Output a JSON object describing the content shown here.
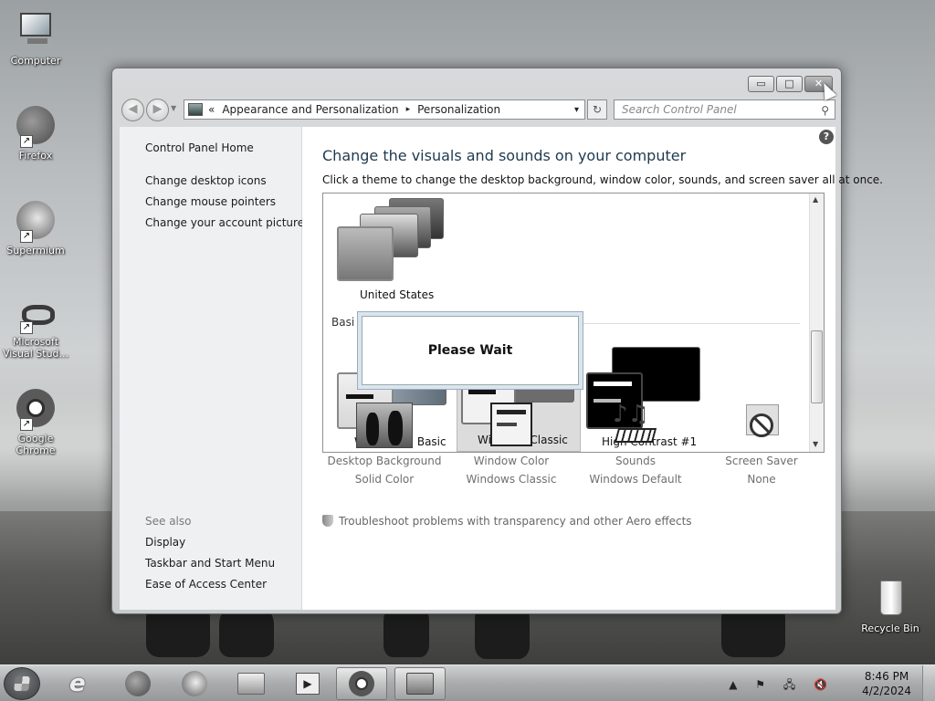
{
  "desktop": {
    "icons": [
      {
        "label": "Computer",
        "icon": "computer-icon"
      },
      {
        "label": "Firefox",
        "icon": "firefox-icon"
      },
      {
        "label": "Supermium",
        "icon": "supermium-icon"
      },
      {
        "label": "Microsoft Visual Stud...",
        "icon": "visual-studio-icon"
      },
      {
        "label": "Google Chrome",
        "icon": "chrome-icon"
      },
      {
        "label": "Recycle Bin",
        "icon": "recycle-bin-icon"
      }
    ]
  },
  "window": {
    "caption_buttons": {
      "minimize": "▭",
      "maximize": "□",
      "close": "✕"
    },
    "breadcrumb": {
      "prefix": "«",
      "parent": "Appearance and Personalization",
      "separator": "▸",
      "current": "Personalization",
      "dropdown": "▾"
    },
    "refresh_glyph": "↻",
    "search": {
      "placeholder": "Search Control Panel",
      "icon": "⚲"
    },
    "left_pane": {
      "home": "Control Panel Home",
      "links": [
        "Change desktop icons",
        "Change mouse pointers",
        "Change your account picture"
      ],
      "see_also_label": "See also",
      "see_also": [
        "Display",
        "Taskbar and Start Menu",
        "Ease of Access Center"
      ]
    },
    "main": {
      "help": "?",
      "title": "Change the visuals and sounds on your computer",
      "subtitle": "Click a theme to change the desktop background, window color, sounds, and screen saver all at once.",
      "my_theme": "United States",
      "basic_section_partial": "Basi",
      "themes": [
        "Windows 7 Basic",
        "Windows Classic",
        "High Contrast #1"
      ],
      "selected_theme": "Windows Classic",
      "dialog_text": "Please Wait",
      "bottom": [
        {
          "title": "Desktop Background",
          "value": "Solid Color",
          "icon": "penguins-icon"
        },
        {
          "title": "Window Color",
          "value": "Windows Classic",
          "icon": "window-color-icon"
        },
        {
          "title": "Sounds",
          "value": "Windows Default",
          "icon": "sounds-icon"
        },
        {
          "title": "Screen Saver",
          "value": "None",
          "icon": "screen-saver-icon"
        }
      ],
      "troubleshoot": "Troubleshoot problems with transparency and other Aero effects"
    }
  },
  "taskbar": {
    "buttons": [
      "start-orb",
      "internet-explorer",
      "firefox",
      "supermium",
      "file-explorer",
      "media-player",
      "chrome",
      "control-panel"
    ],
    "tray": "▲ ⚑ 🖧 🔇",
    "time": "8:46 PM",
    "date": "4/2/2024"
  }
}
